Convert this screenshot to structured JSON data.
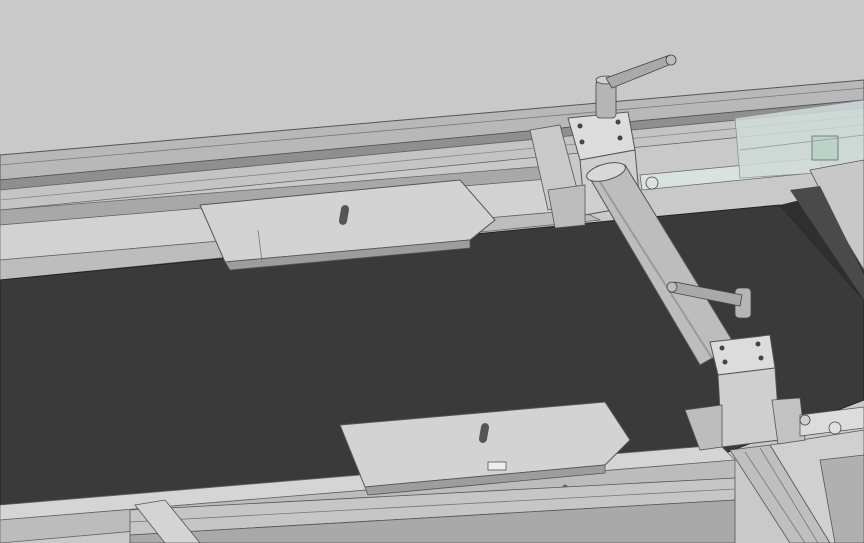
{
  "colors": {
    "background": "#c9c9c9",
    "belt": "#3a3a3a",
    "rail_light": "#d6d6d6",
    "rail_mid": "#b5b5b5",
    "rail_dark": "#8e8e8e",
    "guide_block": "#d3d3d3",
    "roller": "#bdbdbd",
    "bearing_housing": "#cfcfcf",
    "lever": "#a9a9a9",
    "pneumatic_cylinder": "#cdd9d6",
    "outline": "#4a4a4a"
  },
  "icons": {
    "clamp_lever": "adjustable-clamp-lever-icon",
    "bolt": "hex-bolt-icon"
  }
}
